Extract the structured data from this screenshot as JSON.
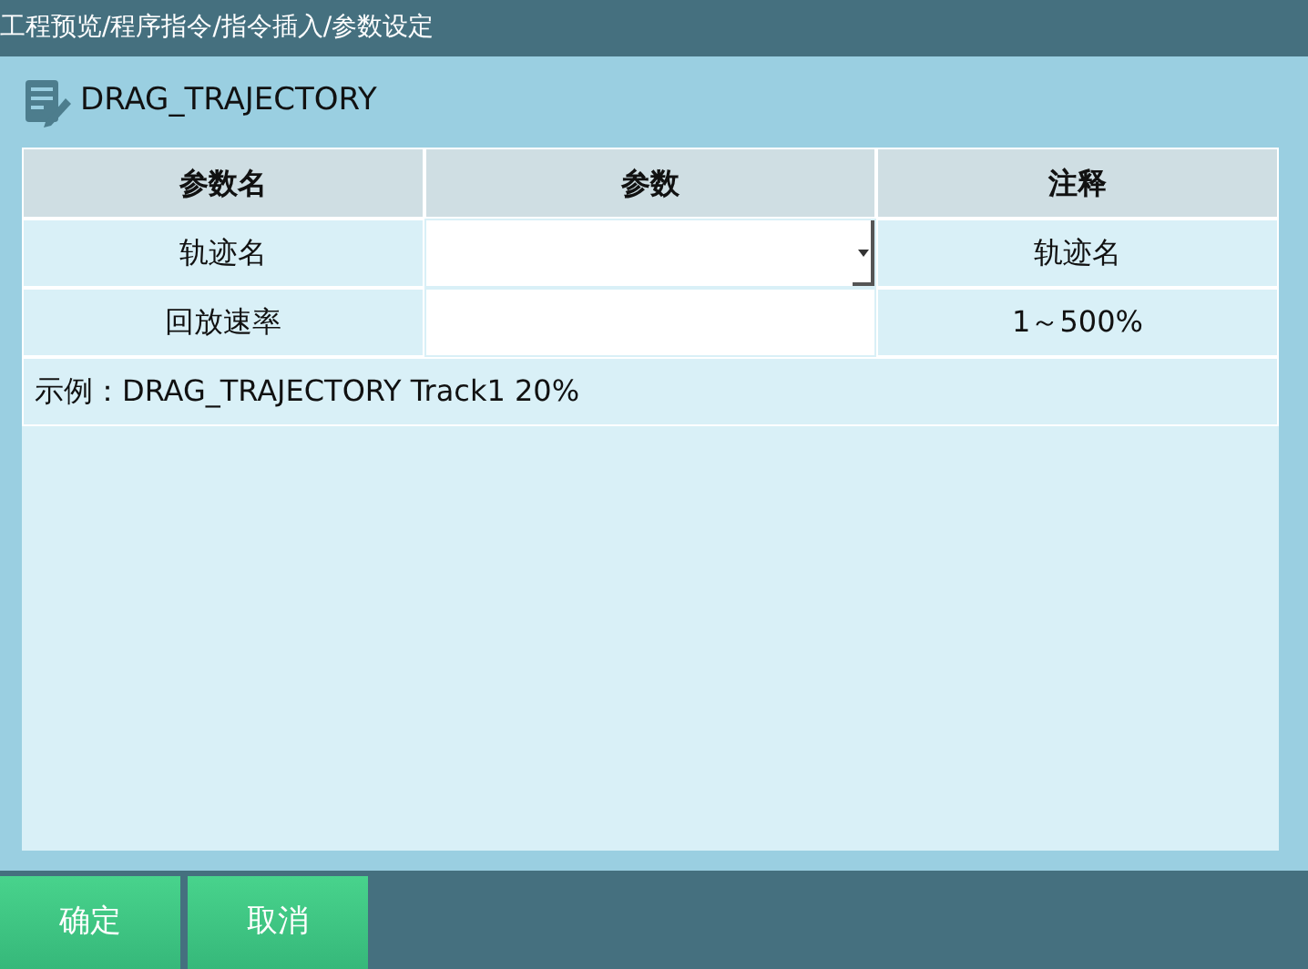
{
  "breadcrumb": "工程预览/程序指令/指令插入/参数设定",
  "instruction": {
    "title": "DRAG_TRAJECTORY"
  },
  "table": {
    "columns": [
      "参数名",
      "参数",
      "注释"
    ],
    "rows": [
      {
        "name": "轨迹名",
        "kind": "dropdown",
        "note": "轨迹名"
      },
      {
        "name": "回放速率",
        "kind": "text",
        "note": "1～500%"
      }
    ],
    "example": "示例：DRAG_TRAJECTORY Track1 20%"
  },
  "buttons": [
    "确定",
    "取消"
  ]
}
